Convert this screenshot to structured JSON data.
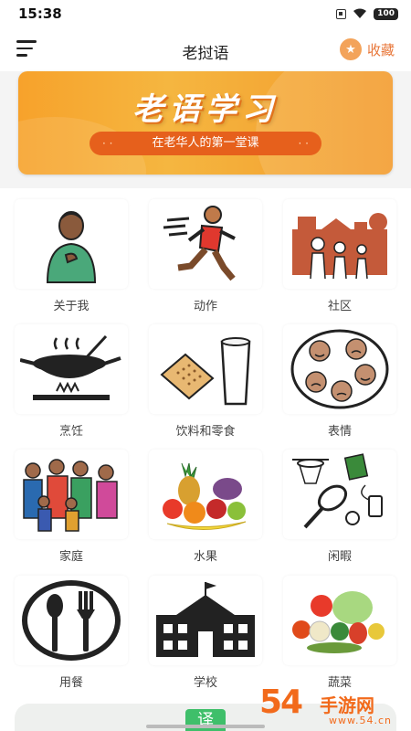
{
  "status_bar": {
    "time": "15:38",
    "battery": "100"
  },
  "header": {
    "title": "老挝语",
    "favorites_label": "收藏"
  },
  "banner": {
    "title": "老语学习",
    "subtitle": "在老华人的第一堂课"
  },
  "categories": [
    {
      "label": "关于我",
      "icon": "person-icon"
    },
    {
      "label": "动作",
      "icon": "running-person-icon"
    },
    {
      "label": "社区",
      "icon": "community-icon"
    },
    {
      "label": "烹饪",
      "icon": "frying-pan-icon"
    },
    {
      "label": "饮料和零食",
      "icon": "cracker-glass-icon"
    },
    {
      "label": "表情",
      "icon": "faces-plate-icon"
    },
    {
      "label": "家庭",
      "icon": "family-icon"
    },
    {
      "label": "水果",
      "icon": "fruit-icon"
    },
    {
      "label": "闲暇",
      "icon": "leisure-icon"
    },
    {
      "label": "用餐",
      "icon": "spoon-fork-icon"
    },
    {
      "label": "学校",
      "icon": "school-icon"
    },
    {
      "label": "蔬菜",
      "icon": "vegetables-icon"
    }
  ],
  "bottom": {
    "translate_label": "译"
  },
  "watermark": {
    "number": "54",
    "text": "手游网",
    "domain": "www.54.cn"
  }
}
